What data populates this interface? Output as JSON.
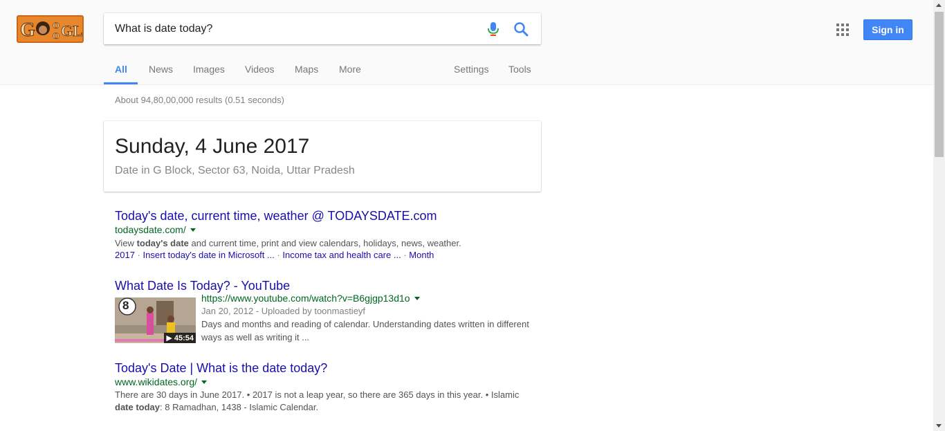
{
  "logo": {
    "alt": "Google"
  },
  "search": {
    "query": "What is date today?",
    "placeholder": ""
  },
  "header": {
    "signin_label": "Sign in"
  },
  "tabs": [
    {
      "label": "All",
      "active": true
    },
    {
      "label": "News"
    },
    {
      "label": "Images"
    },
    {
      "label": "Videos"
    },
    {
      "label": "Maps"
    },
    {
      "label": "More"
    },
    {
      "label": "Settings"
    },
    {
      "label": "Tools"
    }
  ],
  "stats": "About 94,80,00,000 results (0.51 seconds)",
  "answer": {
    "date": "Sunday, 4 June 2017",
    "location": "Date in G Block, Sector 63, Noida, Uttar Pradesh"
  },
  "results": [
    {
      "title": "Today's date, current time, weather @ TODAYSDATE.com",
      "url": "todaysdate.com/",
      "snippet_pre": "View ",
      "snippet_bold": "today's date",
      "snippet_post": " and current time, print and view calendars, holidays, news, weather.",
      "sitelinks": [
        "2017",
        "Insert today's date in Microsoft ...",
        "Income tax and health care ...",
        "Month"
      ]
    },
    {
      "title": "What Date Is Today? - YouTube",
      "url": "https://www.youtube.com/watch?v=B6gjgp13d1o",
      "date_line": "Jan 20, 2012 - Uploaded by toonmastieyf",
      "snippet": "Days and months and reading of calendar. Understanding dates written in different ways as well as writing it ...",
      "duration": "▶ 45:54",
      "thumb_badge": "8"
    },
    {
      "title": "Today's Date | What is the date today?",
      "url": "www.wikidates.org/",
      "snippet_pre": "There are 30 days in June 2017. • 2017 is not a leap year, so there are 365 days in this year. • Islamic ",
      "snippet_bold": "date today",
      "snippet_post": ": 8 Ramadhan, 1438 - Islamic Calendar."
    }
  ],
  "colors": {
    "accent": "#4285f4",
    "link": "#1a0dab",
    "url_green": "#006621",
    "snippet": "#545454"
  }
}
